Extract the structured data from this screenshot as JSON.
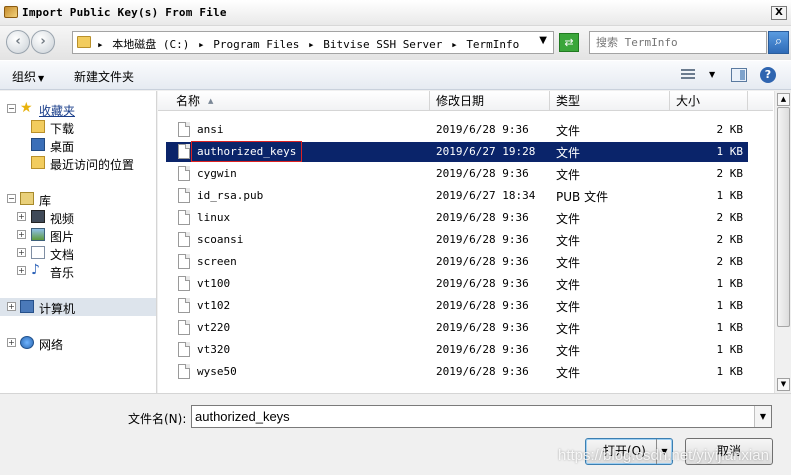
{
  "window": {
    "title": "Import Public Key(s) From File",
    "close_glyph": "X"
  },
  "address_bar": {
    "crumbs": [
      "本地磁盘 (C:)",
      "Program Files",
      "Bitvise SSH Server",
      "TermInfo"
    ],
    "separator": "▸"
  },
  "search": {
    "placeholder": "搜索 TermInfo"
  },
  "toolbar": {
    "organize_label": "组织",
    "new_folder_label": "新建文件夹"
  },
  "nav_tree": {
    "favorites": "收藏夹",
    "downloads": "下载",
    "desktop": "桌面",
    "recent": "最近访问的位置",
    "libraries": "库",
    "videos": "视频",
    "pictures": "图片",
    "documents": "文档",
    "music": "音乐",
    "computer": "计算机",
    "network": "网络"
  },
  "columns": {
    "name": "名称",
    "date": "修改日期",
    "type": "类型",
    "size": "大小"
  },
  "files": [
    {
      "name": "ansi",
      "date": "2019/6/28 9:36",
      "type": "文件",
      "size": "2 KB"
    },
    {
      "name": "authorized_keys",
      "date": "2019/6/27 19:28",
      "type": "文件",
      "size": "1 KB"
    },
    {
      "name": "cygwin",
      "date": "2019/6/28 9:36",
      "type": "文件",
      "size": "2 KB"
    },
    {
      "name": "id_rsa.pub",
      "date": "2019/6/27 18:34",
      "type": "PUB 文件",
      "size": "1 KB"
    },
    {
      "name": "linux",
      "date": "2019/6/28 9:36",
      "type": "文件",
      "size": "2 KB"
    },
    {
      "name": "scoansi",
      "date": "2019/6/28 9:36",
      "type": "文件",
      "size": "2 KB"
    },
    {
      "name": "screen",
      "date": "2019/6/28 9:36",
      "type": "文件",
      "size": "2 KB"
    },
    {
      "name": "vt100",
      "date": "2019/6/28 9:36",
      "type": "文件",
      "size": "1 KB"
    },
    {
      "name": "vt102",
      "date": "2019/6/28 9:36",
      "type": "文件",
      "size": "1 KB"
    },
    {
      "name": "vt220",
      "date": "2019/6/28 9:36",
      "type": "文件",
      "size": "1 KB"
    },
    {
      "name": "vt320",
      "date": "2019/6/28 9:36",
      "type": "文件",
      "size": "1 KB"
    },
    {
      "name": "wyse50",
      "date": "2019/6/28 9:36",
      "type": "文件",
      "size": "1 KB"
    }
  ],
  "selected_file_index": 1,
  "filename": {
    "label": "文件名(N):",
    "value": "authorized_keys"
  },
  "buttons": {
    "open_label": "打开(O)",
    "cancel_label": "取消"
  },
  "watermark": "https://blog.csdn.net/yiyijianxian",
  "colors": {
    "selection": "#0a246a",
    "highlight_box": "#dd2222"
  }
}
